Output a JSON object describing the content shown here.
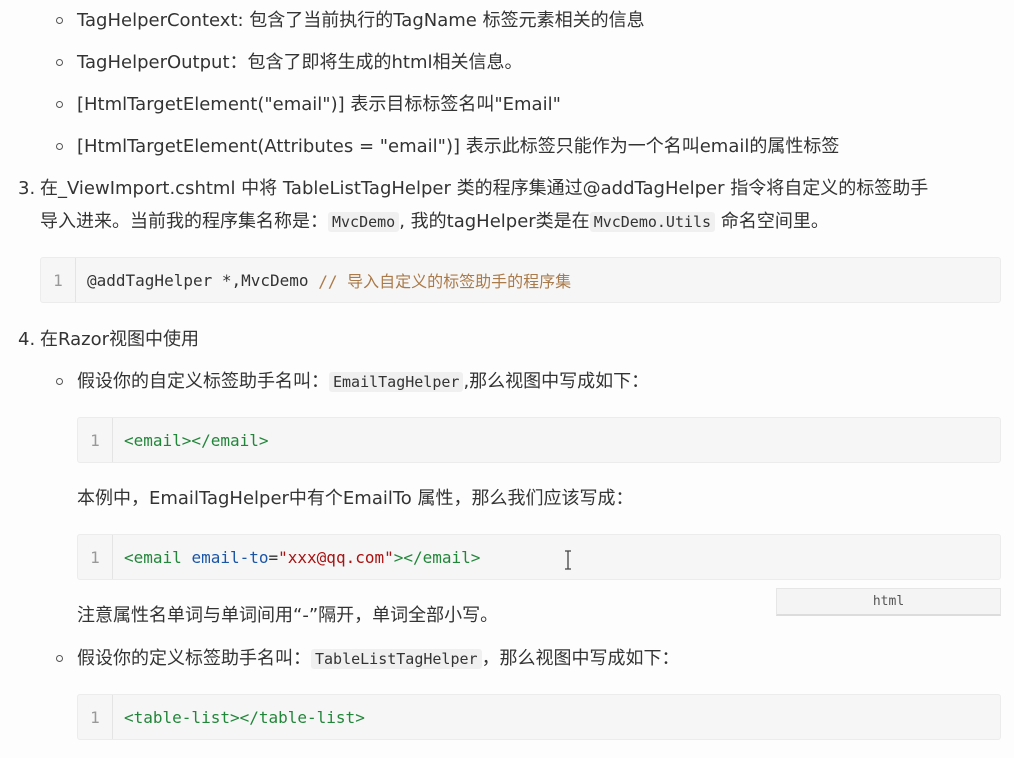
{
  "bullets_top": [
    "TagHelperContext: 包含了当前执行的TagName 标签元素相关的信息",
    "TagHelperOutput：包含了即将生成的html相关信息。",
    "[HtmlTargetElement(\"email\")] 表示目标标签名叫\"Email\"",
    "[HtmlTargetElement(Attributes = \"email\")] 表示此标签只能作为一个名叫email的属性标签"
  ],
  "step3": {
    "number": "3.",
    "line1": "在_ViewImport.cshtml 中将 TableListTagHelper 类的程序集通过@addTagHelper 指令将自定义的标签助手",
    "line2_a": "导入进来。当前我的程序集名称是：",
    "line2_code1": "MvcDemo",
    "line2_b": ", 我的tagHelper类是在",
    "line2_code2": "MvcDemo.Utils",
    "line2_c": " 命名空间里。",
    "code": {
      "line_no": "1",
      "directive": "@addTagHelper",
      "rest": " *,MvcDemo ",
      "comment": "// 导入自定义的标签助手的程序集"
    }
  },
  "step4": {
    "number": "4.",
    "title": "在Razor视图中使用",
    "sub1": {
      "text_a": "假设你的自定义标签助手名叫：",
      "code": "EmailTagHelper",
      "text_b": ",那么视图中写成如下：",
      "block": {
        "line_no": "1",
        "tag": "<email></email>"
      }
    },
    "para1": "本例中，EmailTagHelper中有个EmailTo 属性，那么我们应该写成：",
    "block2": {
      "line_no": "1",
      "open": "<email ",
      "attr": "email-to",
      "eq": "=",
      "str": "\"xxx@qq.com\"",
      "close": "></email>"
    },
    "lang_label": "html",
    "para2": "注意属性名单词与单词间用“-”隔开，单词全部小写。",
    "sub2": {
      "text_a": "假设你的定义标签助手名叫：",
      "code": "TableListTagHelper",
      "text_b": "，那么视图中写成如下：",
      "block": {
        "line_no": "1",
        "tag": "<table-list></table-list>"
      }
    }
  }
}
